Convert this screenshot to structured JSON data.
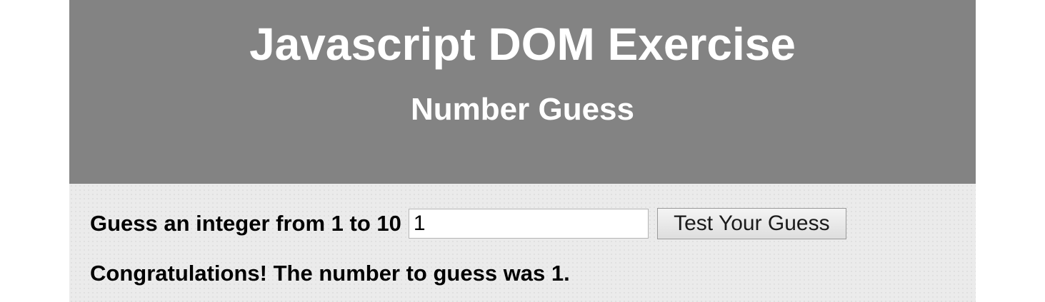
{
  "header": {
    "title": "Javascript DOM Exercise",
    "subtitle": "Number Guess"
  },
  "form": {
    "label": "Guess an integer from 1 to 10",
    "input_value": "1",
    "button_label": "Test Your Guess"
  },
  "result": {
    "message": "Congratulations! The number to guess was 1."
  }
}
